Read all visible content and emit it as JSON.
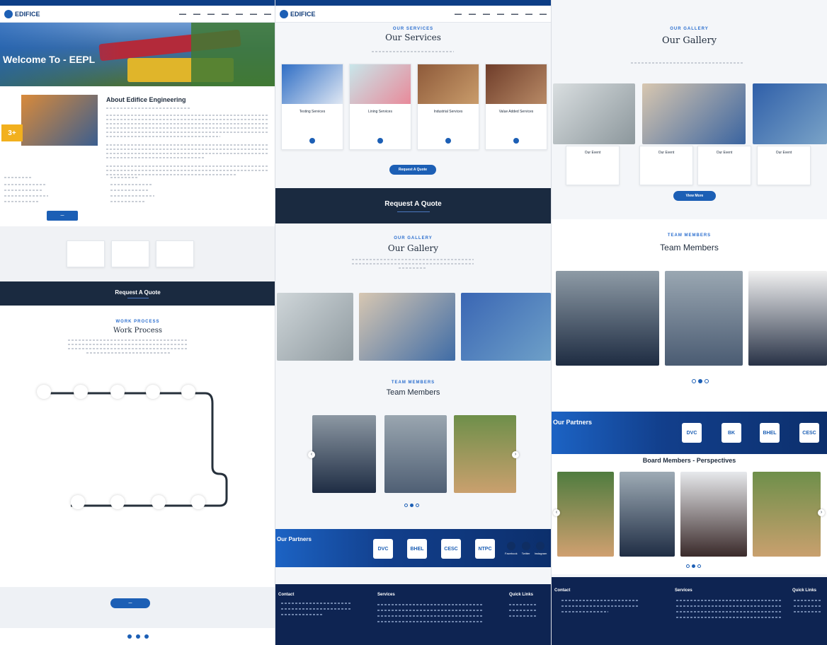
{
  "brand": {
    "name": "EDIFICE",
    "accent": "#1c5fb5",
    "dark": "#1a2a40"
  },
  "hero": {
    "title": "Welcome To - EEPL",
    "badge": "3+"
  },
  "about": {
    "title": "About Edifice Engineering"
  },
  "col1": {
    "quote_title": "Request A Quote",
    "process_kicker": "WORK PROCESS",
    "process_title": "Work Process"
  },
  "col2": {
    "services_kicker": "OUR SERVICES",
    "services_title": "Our Services",
    "service_cards": [
      {
        "title": "Testing Services"
      },
      {
        "title": "Lining Services"
      },
      {
        "title": "Industrial Services"
      },
      {
        "title": "Value Added Services"
      }
    ],
    "quote_button": "Request A Quote",
    "quote_title": "Request A Quote",
    "gallery_kicker": "OUR GALLERY",
    "gallery_title": "Our Gallery",
    "team_kicker": "TEAM MEMBERS",
    "team_title": "Team Members",
    "partners_title": "Our Partners",
    "partner_logos": [
      "DVC",
      "BHEL",
      "CESC",
      "NTPC"
    ],
    "social": [
      "Facebook",
      "Twitter",
      "Instagram"
    ],
    "footer_contact": "Contact",
    "footer_services": "Services",
    "footer_links": "Quick Links"
  },
  "col3": {
    "gallery_kicker": "OUR GALLERY",
    "gallery_title": "Our Gallery",
    "gallery_cards": [
      "Our Event",
      "Our Event",
      "Our Event",
      "Our Event"
    ],
    "view_more": "View More",
    "team_kicker": "TEAM MEMBERS",
    "team_title": "Team Members",
    "partners_title": "Our Partners",
    "partner_logos": [
      "DVC",
      "BK",
      "BHEL",
      "CESC"
    ],
    "board_title": "Board Members - Perspectives",
    "footer_contact": "Contact",
    "footer_services": "Services",
    "footer_links": "Quick Links"
  }
}
